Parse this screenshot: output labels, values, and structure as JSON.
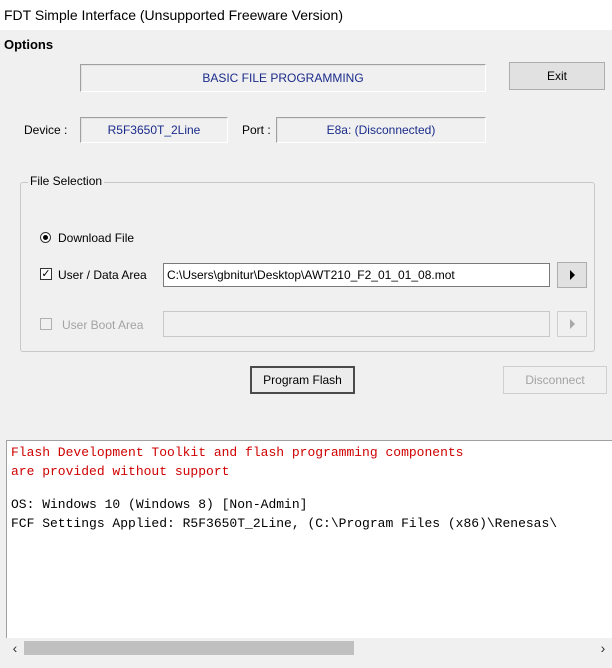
{
  "window": {
    "title": "FDT Simple Interface   (Unsupported Freeware Version)"
  },
  "menu": {
    "options_label": "Options"
  },
  "header": {
    "mode_label": "BASIC FILE PROGRAMMING",
    "exit_label": "Exit"
  },
  "device": {
    "device_label": "Device :",
    "device_value": "R5F3650T_2Line",
    "port_label": "Port :",
    "port_value": "E8a: (Disconnected)"
  },
  "file_selection": {
    "title": "File Selection",
    "download_file_label": "Download File",
    "download_file_selected": true,
    "user_data_area_label": "User / Data Area",
    "user_data_area_checked": true,
    "user_data_area_path": "C:\\Users\\gbnitur\\Desktop\\AWT210_F2_01_01_08.mot",
    "user_boot_area_label": "User Boot Area",
    "user_boot_area_checked": false,
    "user_boot_area_path": ""
  },
  "actions": {
    "program_flash_label": "Program Flash",
    "disconnect_label": "Disconnect"
  },
  "log": {
    "lines": [
      {
        "text": "Flash Development Toolkit and flash programming components",
        "color": "#d00000"
      },
      {
        "text": "are provided without support",
        "color": "#d00000"
      },
      {
        "text": "",
        "color": "#000000"
      },
      {
        "text": "OS: Windows 10 (Windows 8) [Non-Admin]",
        "color": "#000000"
      },
      {
        "text": "FCF Settings Applied: R5F3650T_2Line, (C:\\Program Files (x86)\\Renesas\\",
        "color": "#000000"
      }
    ],
    "scroll_left_icon": "‹",
    "scroll_right_icon": "›"
  },
  "colors": {
    "accent_text": "#1a2b8a",
    "error_text": "#d00000",
    "background": "#f0f0f0"
  }
}
